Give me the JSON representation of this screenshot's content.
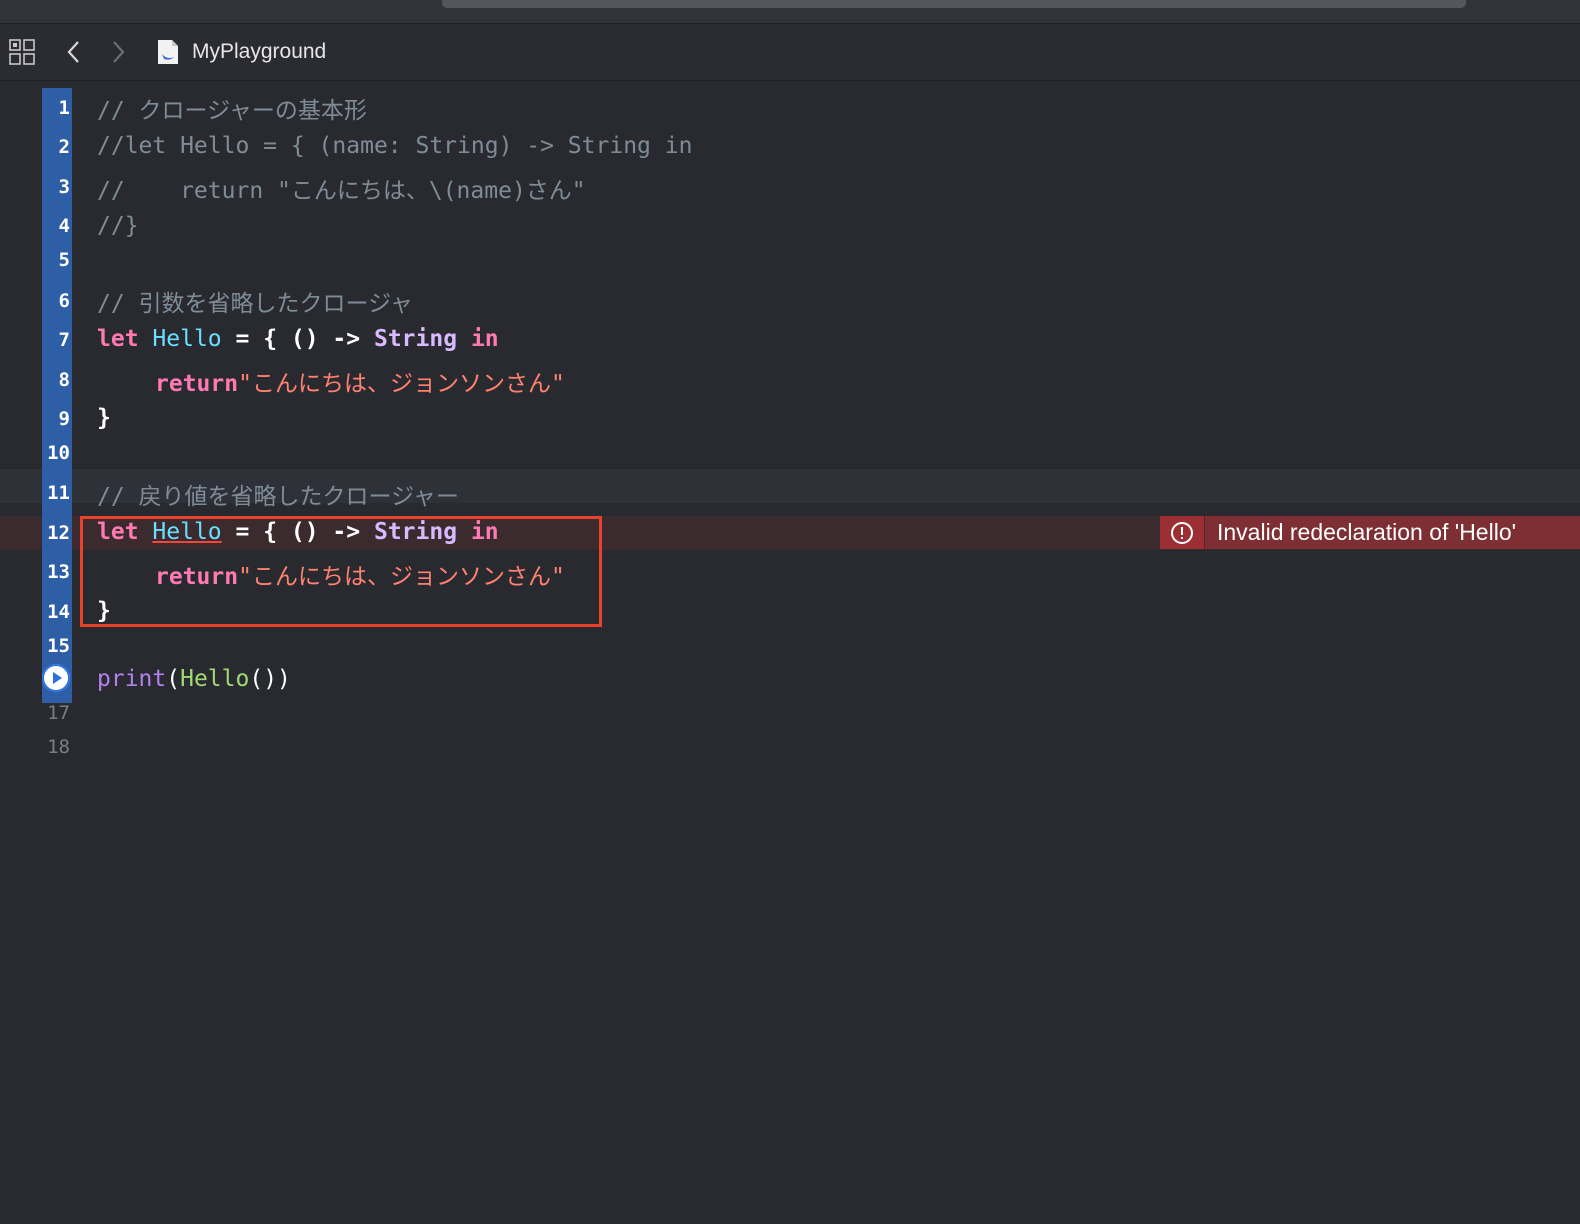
{
  "window": {
    "title": "MyPlayground"
  },
  "toolbar": {
    "icons": [
      "grid-icon",
      "chevron-left-icon",
      "chevron-right-icon",
      "swift-file-icon"
    ]
  },
  "editor": {
    "line_numbers": [
      "1",
      "2",
      "3",
      "4",
      "5",
      "6",
      "7",
      "8",
      "9",
      "10",
      "11",
      "12",
      "13",
      "14",
      "15",
      "17",
      "18"
    ],
    "lines": {
      "l1": "// クロージャーの基本形",
      "l2": "//let Hello = { (name: String) -> String in",
      "l3": "//    return \"こんにちは、\\(name)さん\"",
      "l4": "//}",
      "l6": "// 引数を省略したクロージャ",
      "l7": {
        "kw_let": "let",
        "name": "Hello",
        "op": " = { () -> ",
        "type": "String",
        "sp": " ",
        "kw_in": "in"
      },
      "l8": {
        "kw_return": "return",
        "str": "\"こんにちは、ジョンソンさん\""
      },
      "l9": "}",
      "l11": "// 戻り値を省略したクロージャー",
      "l12": {
        "kw_let": "let",
        "name": "Hello",
        "op": " = { () -> ",
        "type": "String",
        "sp": " ",
        "kw_in": "in"
      },
      "l13": {
        "kw_return": "return",
        "str": "\"こんにちは、ジョンソンさん\""
      },
      "l14": "}",
      "l16": {
        "fn": "print",
        "open": "(",
        "call": "Hello",
        "close": "())"
      }
    },
    "error": {
      "message": "Invalid redeclaration of 'Hello'"
    },
    "colors": {
      "background": "#292a30",
      "gutter_highlight": "#2d5ea6",
      "error_box": "#e8412c",
      "error_badge": "#7d2f33"
    }
  }
}
